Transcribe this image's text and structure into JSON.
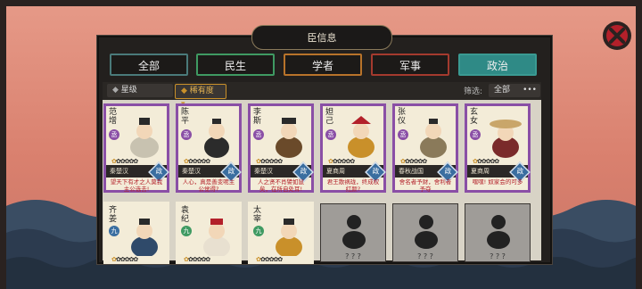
{
  "panel": {
    "title": "臣信息"
  },
  "tabs": [
    {
      "label": "全部",
      "border": "#4a7a7a",
      "active": false
    },
    {
      "label": "民生",
      "border": "#3f9a62",
      "active": false
    },
    {
      "label": "学者",
      "border": "#b8732a",
      "active": false
    },
    {
      "label": "军事",
      "border": "#a43a2e",
      "active": false
    },
    {
      "label": "政治",
      "border": "#3a9a92",
      "active": true
    }
  ],
  "toolbar": {
    "star_label": "星级",
    "rarity_label": "稀有度",
    "filter_label": "筛选:",
    "filter_value": "全部",
    "more_icon": "ellipsis-icon"
  },
  "cards": [
    {
      "name": "范增",
      "level": "丞",
      "level_color": "#8a4fa6",
      "dynasty": "秦楚汉",
      "stars_on": 1,
      "stars_total": 6,
      "badge": "政",
      "desc": "望天下有才之人莫我主公选去!"
    },
    {
      "name": "陈平",
      "level": "丞",
      "level_color": "#8a4fa6",
      "dynasty": "秦楚汉",
      "stars_on": 1,
      "stars_total": 6,
      "badge": "政",
      "desc": "人心，真是善变呢主公觉得?"
    },
    {
      "name": "李斯",
      "level": "丞",
      "level_color": "#8a4fa6",
      "dynasty": "秦楚汉",
      "stars_on": 1,
      "stars_total": 6,
      "badge": "政",
      "desc": "人之贤不肖譬如鼠矣，在所自处耳!"
    },
    {
      "name": "妲己",
      "level": "丞",
      "level_color": "#8a4fa6",
      "dynasty": "夏商周",
      "stars_on": 1,
      "stars_total": 6,
      "badge": "政",
      "desc": "君王散祸珑，终成权红颜?"
    },
    {
      "name": "张仪",
      "level": "丞",
      "level_color": "#8a4fa6",
      "dynasty": "春秋战国",
      "stars_on": 1,
      "stars_total": 6,
      "badge": "政",
      "desc": "舍名者予财，舍利者予夺"
    },
    {
      "name": "玄女",
      "level": "丞",
      "level_color": "#8a4fa6",
      "dynasty": "夏商周",
      "stars_on": 1,
      "stars_total": 6,
      "badge": "政",
      "desc": "嘿嘿! 奴家会的可多"
    },
    {
      "name": "齐姜",
      "level": "九",
      "level_color": "#3a6ea0",
      "dynasty": "",
      "stars_on": 1,
      "stars_total": 6,
      "badge": "",
      "desc": ""
    },
    {
      "name": "袁纪",
      "level": "九",
      "level_color": "#3f9a62",
      "dynasty": "",
      "stars_on": 1,
      "stars_total": 6,
      "badge": "",
      "desc": ""
    },
    {
      "name": "太宰",
      "level": "九",
      "level_color": "#3f9a62",
      "dynasty": "",
      "stars_on": 1,
      "stars_total": 6,
      "badge": "",
      "desc": ""
    }
  ],
  "locked": [
    {
      "text": "? ? ?"
    },
    {
      "text": "? ? ?"
    },
    {
      "text": "? ? ?"
    }
  ]
}
